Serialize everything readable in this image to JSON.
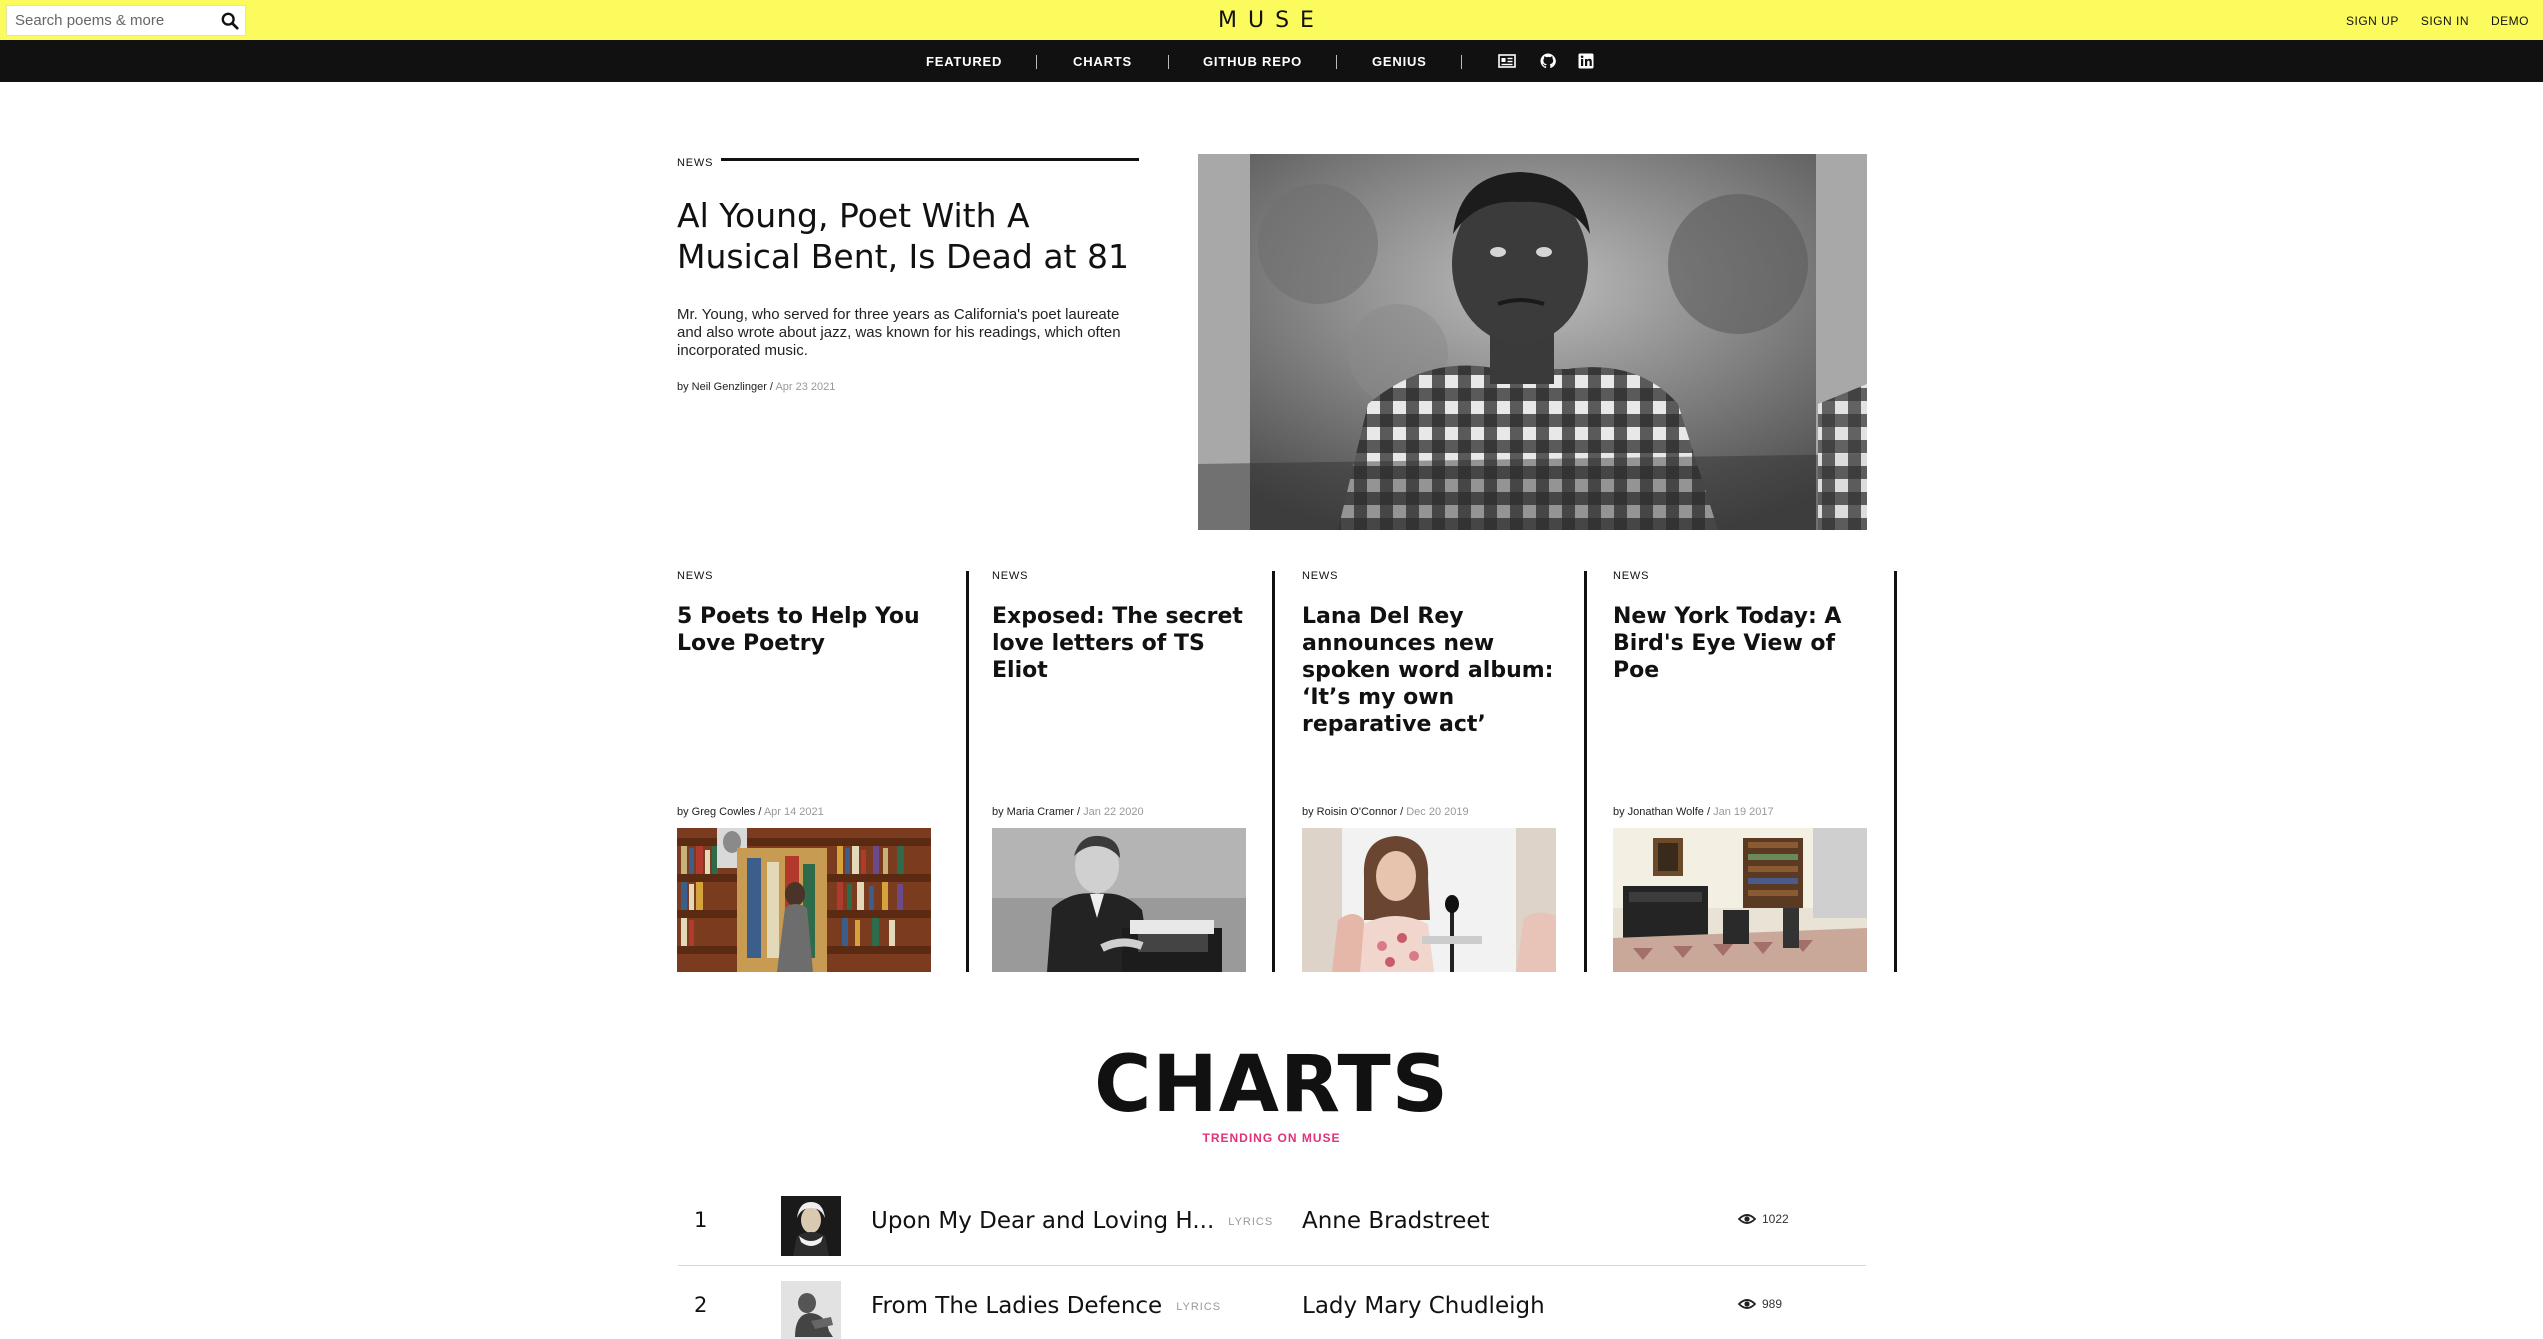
{
  "header": {
    "search_placeholder": "Search poems & more",
    "logo": "MUSE",
    "links": [
      "SIGN UP",
      "SIGN IN",
      "DEMO"
    ]
  },
  "nav": {
    "items": [
      "FEATURED",
      "CHARTS",
      "GITHUB REPO",
      "GENIUS"
    ],
    "icons": [
      "id-card-icon",
      "github-icon",
      "linkedin-icon"
    ]
  },
  "featured": {
    "kicker": "NEWS",
    "title": "Al Young, Poet With A Musical Bent, Is Dead at 81",
    "description": "Mr. Young, who served for three years as California's poet laureate and also wrote about jazz, was known for his readings, which often incorporated music.",
    "author": "by Neil Genzlinger",
    "date": "Apr 23 2021"
  },
  "articles": [
    {
      "kicker": "NEWS",
      "title": "5 Poets to Help You Love Poetry",
      "author": "by Greg Cowles",
      "date": "Apr 14 2021"
    },
    {
      "kicker": "NEWS",
      "title": "Exposed: The secret love letters of TS Eliot",
      "author": "by Maria Cramer",
      "date": "Jan 22 2020"
    },
    {
      "kicker": "NEWS",
      "title": "Lana Del Rey announces new spoken word album: ‘It’s my own reparative act’",
      "author": "by Roisin O'Connor",
      "date": "Dec 20 2019"
    },
    {
      "kicker": "NEWS",
      "title": "New York Today: A Bird's Eye View of Poe",
      "author": "by Jonathan Wolfe",
      "date": "Jan 19 2017"
    }
  ],
  "charts": {
    "title": "CHARTS",
    "subtitle": "TRENDING ON MUSE",
    "rows": [
      {
        "rank": "1",
        "title": "Upon My Dear and Loving H...",
        "tag": "LYRICS",
        "artist": "Anne Bradstreet",
        "views": "1022"
      },
      {
        "rank": "2",
        "title": "From The Ladies Defence",
        "tag": "LYRICS",
        "artist": "Lady Mary Chudleigh",
        "views": "989"
      }
    ]
  },
  "colors": {
    "topbar": "#fbfb5e",
    "navbar": "#111111",
    "accent_pink": "#e0317a"
  }
}
